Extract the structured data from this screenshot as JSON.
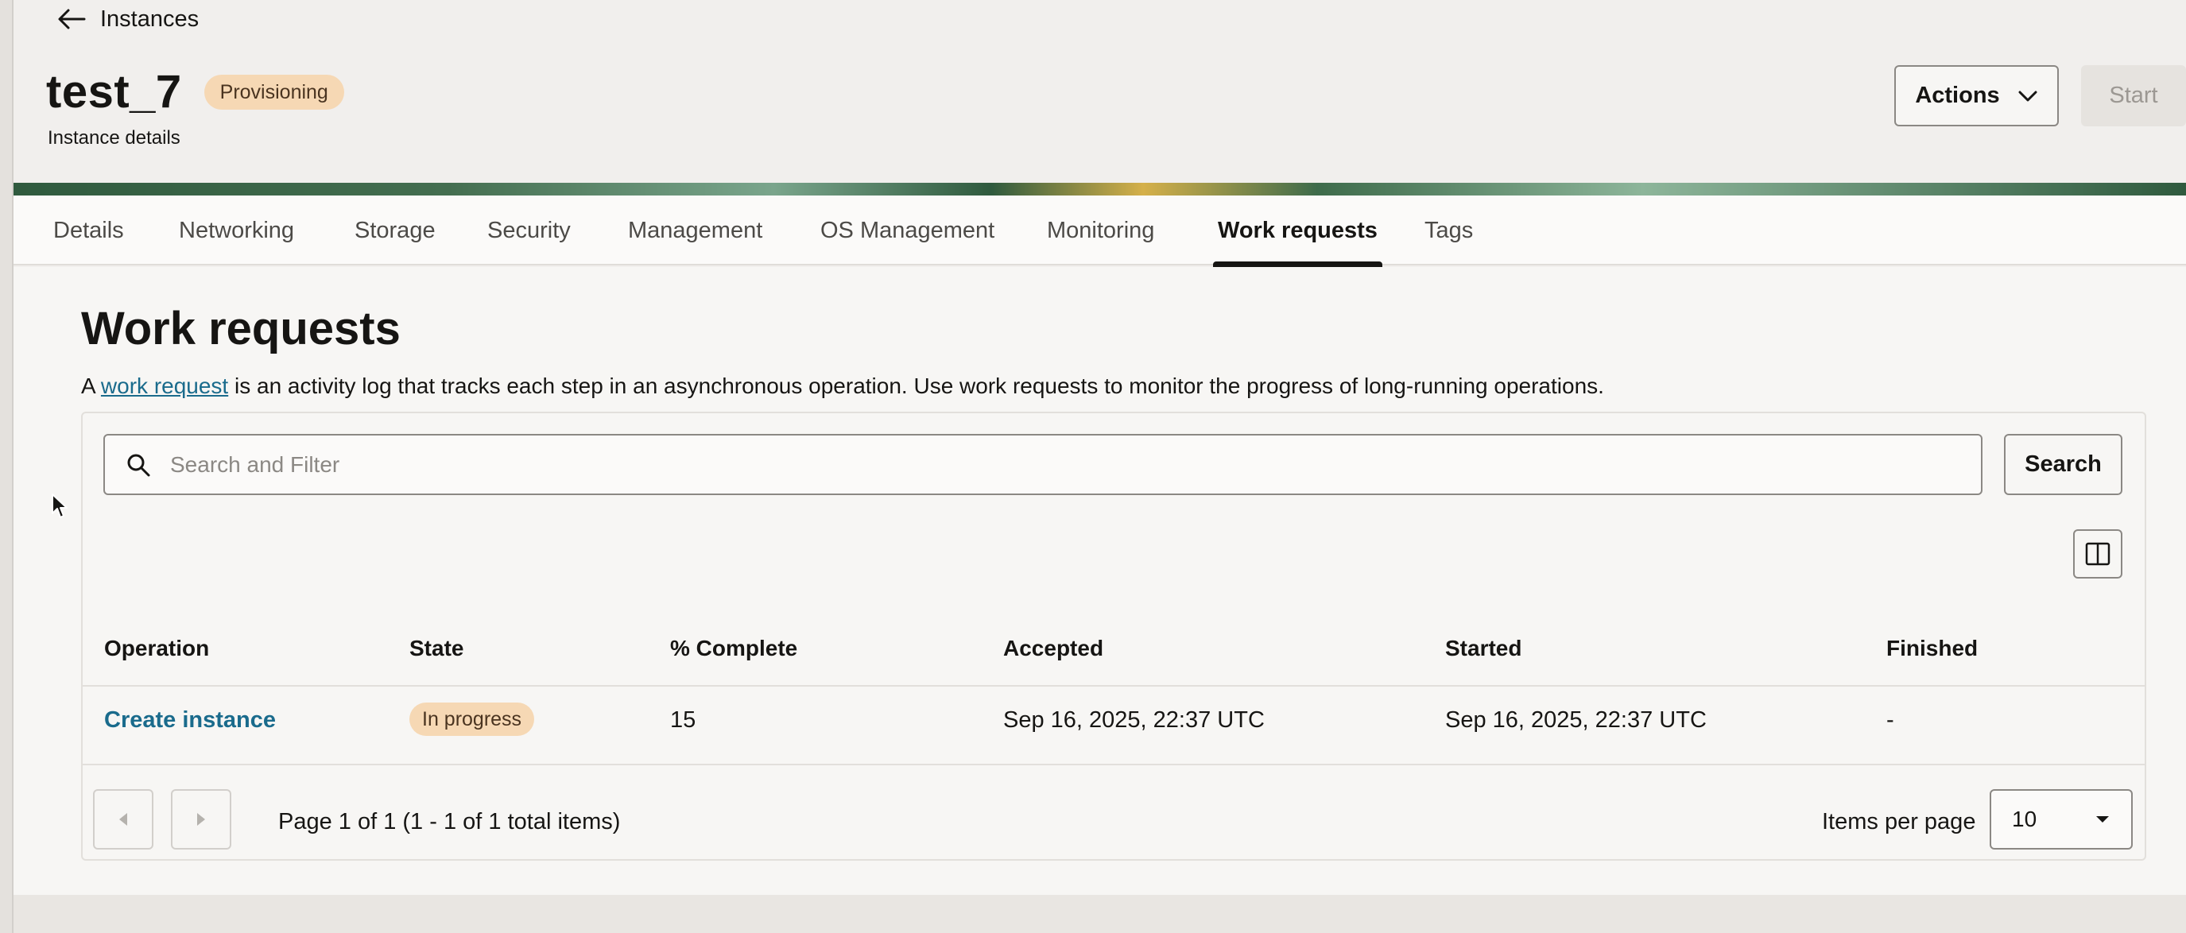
{
  "nav": {
    "back_label": "Instances"
  },
  "header": {
    "title": "test_7",
    "status_badge": "Provisioning",
    "subtitle": "Instance details",
    "actions_label": "Actions",
    "start_label": "Start"
  },
  "tabs": [
    {
      "label": "Details",
      "active": false
    },
    {
      "label": "Networking",
      "active": false
    },
    {
      "label": "Storage",
      "active": false
    },
    {
      "label": "Security",
      "active": false
    },
    {
      "label": "Management",
      "active": false
    },
    {
      "label": "OS Management",
      "active": false
    },
    {
      "label": "Monitoring",
      "active": false
    },
    {
      "label": "Work requests",
      "active": true
    },
    {
      "label": "Tags",
      "active": false
    }
  ],
  "section": {
    "title": "Work requests",
    "desc_prefix": "A ",
    "desc_link": "work request",
    "desc_suffix": " is an activity log that tracks each step in an asynchronous operation. Use work requests to monitor the progress of long-running operations."
  },
  "search": {
    "placeholder": "Search and Filter",
    "button_label": "Search"
  },
  "table": {
    "headers": [
      "Operation",
      "State",
      "% Complete",
      "Accepted",
      "Started",
      "Finished"
    ],
    "rows": [
      {
        "operation": "Create instance",
        "state": "In progress",
        "percent_complete": "15",
        "accepted": "Sep 16, 2025, 22:37 UTC",
        "started": "Sep 16, 2025, 22:37 UTC",
        "finished": "-"
      }
    ]
  },
  "pagination": {
    "summary": "Page 1 of 1 (1 - 1 of 1 total items)",
    "items_per_page_label": "Items per page",
    "items_per_page_value": "10"
  },
  "colors": {
    "link": "#1a6b8c",
    "badge_bg": "#f6d8b4",
    "page_bg": "#f1efed"
  },
  "icons": {
    "back": "arrow-left-icon",
    "actions": "chevron-down-icon",
    "search": "search-icon",
    "columns": "columns-icon",
    "prev": "caret-left-icon",
    "next": "caret-right-icon",
    "select": "caret-down-icon"
  }
}
